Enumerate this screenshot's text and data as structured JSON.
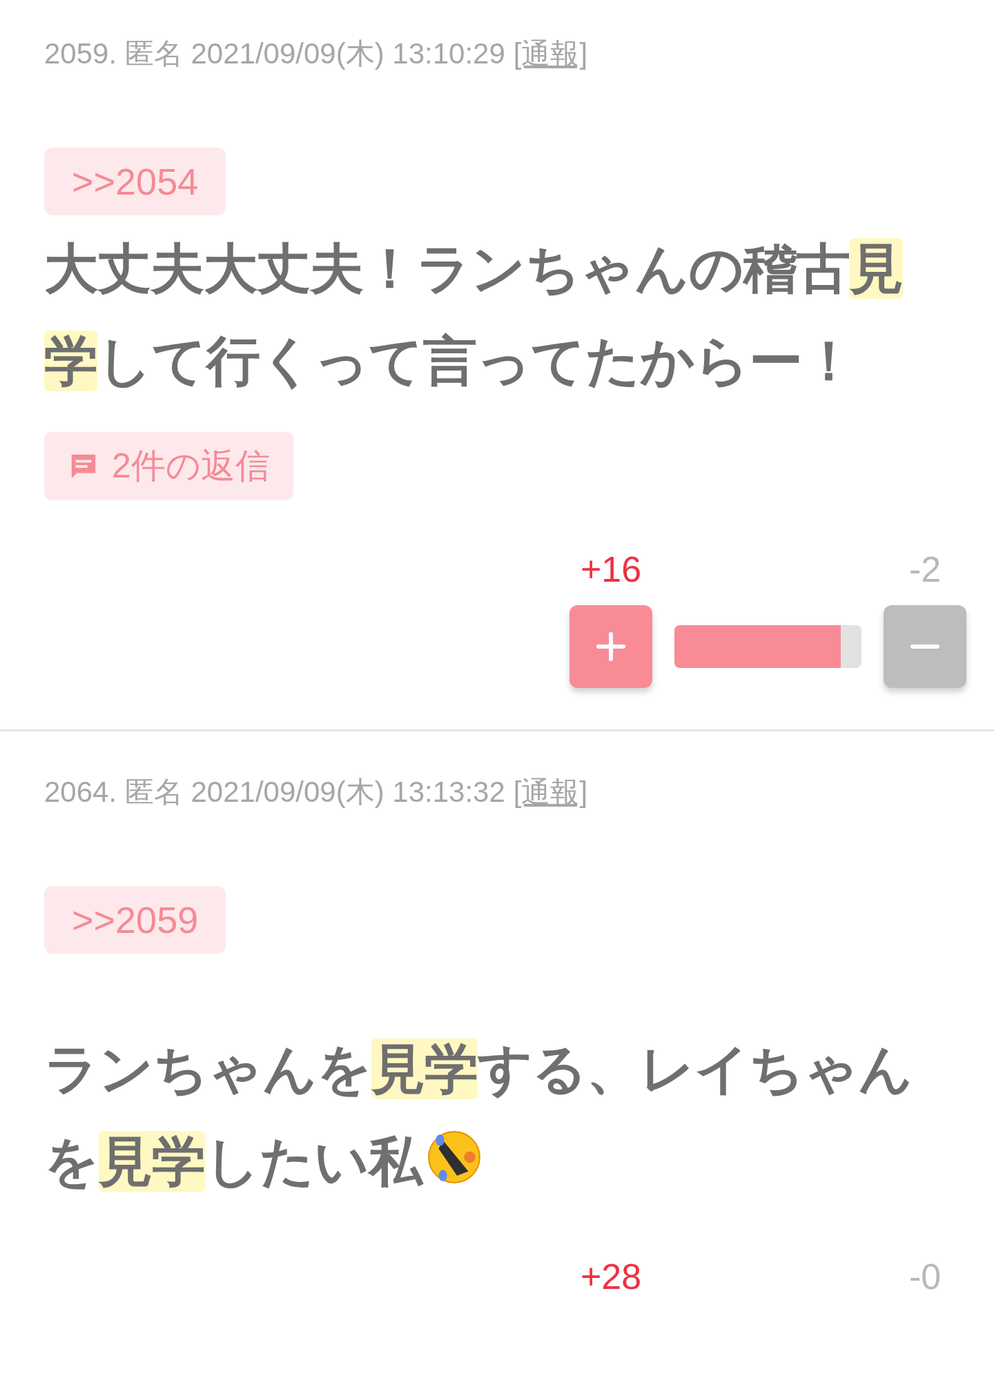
{
  "posts": [
    {
      "number": "2059.",
      "name": "匿名",
      "date": "2021/09/09(木) 13:10:29",
      "report": "[通報]",
      "quote": ">>2054",
      "body": [
        {
          "kind": "text",
          "text": "大丈夫大丈夫！ランちゃんの稽古",
          "highlighted": false
        },
        {
          "kind": "text",
          "text": "見",
          "highlighted": true
        },
        {
          "kind": "text",
          "text": "学",
          "highlighted": true
        },
        {
          "kind": "text",
          "text": "して行くって言ってたからー！",
          "highlighted": false
        }
      ],
      "replies": "2件の返信",
      "votes": {
        "up": "+16",
        "down": "-2",
        "level": 0.89
      }
    },
    {
      "number": "2064.",
      "name": "匿名",
      "date": "2021/09/09(木) 13:13:32",
      "report": "[通報]",
      "quote": ">>2059",
      "body": [
        {
          "kind": "text",
          "text": "ランちゃんを",
          "highlighted": false
        },
        {
          "kind": "text",
          "text": "見学",
          "highlighted": true
        },
        {
          "kind": "text",
          "text": "する、レイちゃんを",
          "highlighted": false
        },
        {
          "kind": "text",
          "text": "見学",
          "highlighted": true
        },
        {
          "kind": "text",
          "text": "したい私",
          "highlighted": false
        },
        {
          "kind": "emoji"
        }
      ],
      "votes": {
        "up": "+28",
        "down": "-0"
      }
    }
  ]
}
